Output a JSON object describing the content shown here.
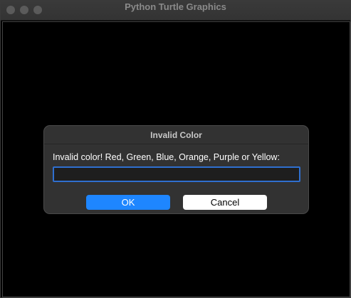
{
  "window": {
    "title": "Python Turtle Graphics"
  },
  "dialog": {
    "title": "Invalid Color",
    "prompt": "Invalid color! Red, Green, Blue, Orange, Purple or Yellow:",
    "input_value": "",
    "ok_label": "OK",
    "cancel_label": "Cancel"
  },
  "colors": {
    "canvas": "#000000",
    "dialog_bg": "#323232",
    "ok_button": "#1e86ff",
    "cancel_button": "#ffffff",
    "input_focus_border": "#2f6fcf"
  },
  "icons": [
    "close-button-dot",
    "minimize-button-dot",
    "zoom-button-dot"
  ]
}
